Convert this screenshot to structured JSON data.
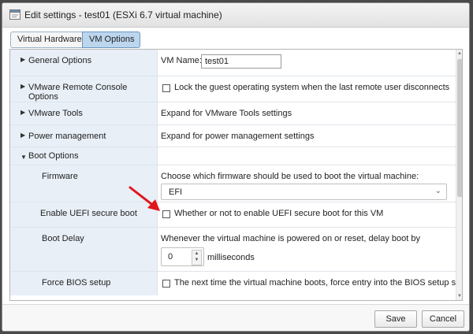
{
  "window": {
    "title": "Edit settings - test01 (ESXi 6.7 virtual machine)"
  },
  "tabs": [
    {
      "label": "Virtual Hardware"
    },
    {
      "label": "VM Options",
      "selected": true
    }
  ],
  "settings": {
    "general": {
      "label": "General Options",
      "vm_name_label": "VM Name:",
      "vm_name_value": "test01"
    },
    "remote_console": {
      "label": "VMware Remote Console Options",
      "checkbox_text": "Lock the guest operating system when the last remote user disconnects"
    },
    "tools": {
      "label": "VMware Tools",
      "value": "Expand for VMware Tools settings"
    },
    "power": {
      "label": "Power management",
      "value": "Expand for power management settings"
    },
    "boot": {
      "label": "Boot Options",
      "firmware": {
        "label": "Firmware",
        "text": "Choose which firmware should be used to boot the virtual machine:",
        "selected": "EFI"
      },
      "uefi": {
        "label": "Enable UEFI secure boot",
        "checkbox_text": "Whether or not to enable UEFI secure boot for this VM"
      },
      "delay": {
        "label": "Boot Delay",
        "text": "Whenever the virtual machine is powered on or reset, delay boot by",
        "value": "0",
        "unit": "milliseconds"
      },
      "bios": {
        "label": "Force BIOS setup",
        "checkbox_text": "The next time the virtual machine boots, force entry into the BIOS setup screen."
      }
    }
  },
  "footer": {
    "save_label": "Save",
    "cancel_label": "Cancel"
  },
  "colors": {
    "accent": "#bcd6ee",
    "label_bg": "#e8eff7",
    "arrow": "#e0161d"
  }
}
